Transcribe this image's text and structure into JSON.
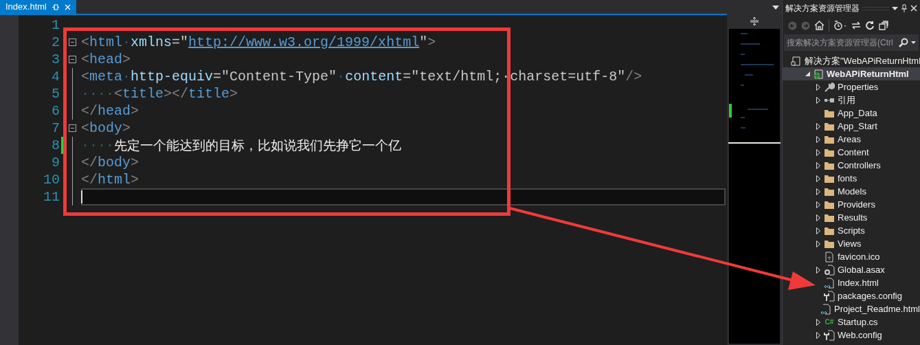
{
  "editor": {
    "tab": {
      "title": "Index.html",
      "selected": true
    },
    "lines": [
      {
        "number": "1"
      },
      {
        "number": "2",
        "fold": true,
        "tokens": [
          {
            "kind": "punct",
            "text": "<"
          },
          {
            "kind": "tag",
            "text": "html"
          },
          {
            "kind": "ws",
            "text": "·"
          },
          {
            "kind": "attr",
            "text": "xmlns"
          },
          {
            "kind": "value",
            "text": "=\""
          },
          {
            "kind": "link",
            "text": "http://www.w3.org/1999/xhtml"
          },
          {
            "kind": "value",
            "text": "\""
          },
          {
            "kind": "punct",
            "text": ">"
          }
        ]
      },
      {
        "number": "3",
        "fold": true,
        "tokens": [
          {
            "kind": "punct",
            "text": "<"
          },
          {
            "kind": "tag",
            "text": "head"
          },
          {
            "kind": "punct",
            "text": ">"
          }
        ]
      },
      {
        "number": "4",
        "tokens": [
          {
            "kind": "punct",
            "text": "<"
          },
          {
            "kind": "tag",
            "text": "meta"
          },
          {
            "kind": "ws",
            "text": "·"
          },
          {
            "kind": "attr",
            "text": "http-equiv"
          },
          {
            "kind": "value",
            "text": "=\"Content-Type\""
          },
          {
            "kind": "ws",
            "text": "·"
          },
          {
            "kind": "attr",
            "text": "content"
          },
          {
            "kind": "value",
            "text": "=\"text/html;·charset=utf-8\""
          },
          {
            "kind": "punct",
            "text": "/>"
          }
        ]
      },
      {
        "number": "5",
        "tokens": [
          {
            "kind": "ws",
            "text": "····"
          },
          {
            "kind": "punct",
            "text": "<"
          },
          {
            "kind": "tag",
            "text": "title"
          },
          {
            "kind": "punct",
            "text": "></"
          },
          {
            "kind": "tag",
            "text": "title"
          },
          {
            "kind": "punct",
            "text": ">"
          }
        ]
      },
      {
        "number": "6",
        "tokens": [
          {
            "kind": "punct",
            "text": "</"
          },
          {
            "kind": "tag",
            "text": "head"
          },
          {
            "kind": "punct",
            "text": ">"
          }
        ]
      },
      {
        "number": "7",
        "fold": true,
        "tokens": [
          {
            "kind": "punct",
            "text": "<"
          },
          {
            "kind": "tag",
            "text": "body"
          },
          {
            "kind": "punct",
            "text": ">"
          }
        ]
      },
      {
        "number": "8",
        "changed": true,
        "tokens": [
          {
            "kind": "ws",
            "text": "····"
          },
          {
            "kind": "text",
            "text": "先定一个能达到的目标，比如说我们先挣它一个亿"
          }
        ]
      },
      {
        "number": "9",
        "tokens": [
          {
            "kind": "punct",
            "text": "</"
          },
          {
            "kind": "tag",
            "text": "body"
          },
          {
            "kind": "punct",
            "text": ">"
          }
        ]
      },
      {
        "number": "10",
        "tokens": [
          {
            "kind": "punct",
            "text": "</"
          },
          {
            "kind": "tag",
            "text": "html"
          },
          {
            "kind": "punct",
            "text": ">"
          }
        ]
      },
      {
        "number": "11",
        "current": true
      }
    ]
  },
  "solution_explorer": {
    "title": "解决方案资源管理器",
    "search": {
      "placeholder": "搜索解决方案资源管理器(Ctrl"
    },
    "tree": [
      {
        "label": "解决方案\"WebAPiReturnHtml",
        "kind": "solution",
        "selected": false,
        "children": [
          {
            "label": "WebAPiReturnHtml",
            "kind": "project",
            "selected": true,
            "expandable": true,
            "expanded": true,
            "children": [
              {
                "label": "Properties",
                "kind": "wrench",
                "selected": false,
                "expandable": true,
                "expanded": false
              },
              {
                "label": "引用",
                "kind": "reference",
                "selected": false,
                "expandable": true,
                "expanded": false
              },
              {
                "label": "App_Data",
                "kind": "folder",
                "selected": false,
                "expandable": false
              },
              {
                "label": "App_Start",
                "kind": "folder",
                "selected": false,
                "expandable": true,
                "expanded": false
              },
              {
                "label": "Areas",
                "kind": "folder",
                "selected": false,
                "expandable": true,
                "expanded": false
              },
              {
                "label": "Content",
                "kind": "folder",
                "selected": false,
                "expandable": true,
                "expanded": false
              },
              {
                "label": "Controllers",
                "kind": "folder",
                "selected": false,
                "expandable": true,
                "expanded": false
              },
              {
                "label": "fonts",
                "kind": "folder",
                "selected": false,
                "expandable": true,
                "expanded": false
              },
              {
                "label": "Models",
                "kind": "folder",
                "selected": false,
                "expandable": true,
                "expanded": false
              },
              {
                "label": "Providers",
                "kind": "folder",
                "selected": false,
                "expandable": true,
                "expanded": false
              },
              {
                "label": "Results",
                "kind": "folder",
                "selected": false,
                "expandable": true,
                "expanded": false
              },
              {
                "label": "Scripts",
                "kind": "folder",
                "selected": false,
                "expandable": true,
                "expanded": false
              },
              {
                "label": "Views",
                "kind": "folder",
                "selected": false,
                "expandable": true,
                "expanded": false
              },
              {
                "label": "favicon.ico",
                "kind": "file",
                "selected": false,
                "expandable": false
              },
              {
                "label": "Global.asax",
                "kind": "gearfile",
                "selected": false,
                "expandable": true,
                "expanded": false
              },
              {
                "label": "Index.html",
                "kind": "html",
                "selected": false,
                "expandable": false
              },
              {
                "label": "packages.config",
                "kind": "config",
                "selected": false,
                "expandable": false
              },
              {
                "label": "Project_Readme.html",
                "kind": "html",
                "selected": false,
                "expandable": false
              },
              {
                "label": "Startup.cs",
                "kind": "csharp",
                "icon_text": "C#",
                "selected": false,
                "expandable": true,
                "expanded": false
              },
              {
                "label": "Web.config",
                "kind": "config",
                "selected": false,
                "expandable": true,
                "expanded": false
              }
            ]
          }
        ]
      }
    ]
  }
}
